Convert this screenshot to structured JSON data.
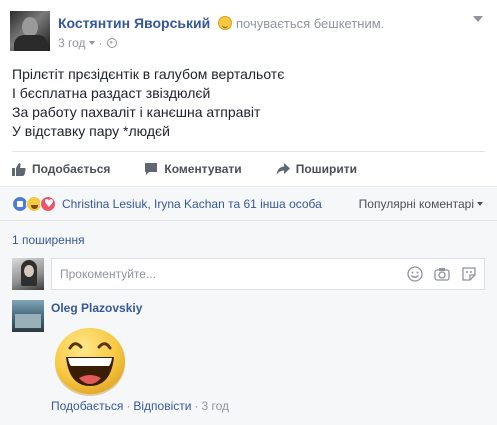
{
  "post": {
    "author": "Костянтин Яворський",
    "activity": "почувається бешкетним.",
    "time": "3 год",
    "lines": [
      "Прілєтіт прєзідєнтік в галубом вертальотє",
      "І бєсплатна раздаст звіздюлєй",
      "За работу пахваліт і канєшна атправіт",
      "У відставку пару *людєй"
    ]
  },
  "actions": {
    "like": "Подобається",
    "comment": "Коментувати",
    "share": "Поширити"
  },
  "reactions": {
    "names": "Christina Lesiuk, Iryna Kachan та 61 інша особа",
    "sort": "Популярні коментарі"
  },
  "shares": "1 поширення",
  "comment_input": {
    "placeholder": "Прокоментуйте..."
  },
  "comment": {
    "author": "Oleg Plazovskiy",
    "like": "Подобається",
    "reply": "Відповісти",
    "time": "3 год"
  },
  "icons": {
    "activity_emoji": "smirk-emoji-icon",
    "privacy": "globe-icon",
    "like": "thumbs-up-icon",
    "comment": "speech-bubble-icon",
    "share": "share-arrow-icon",
    "reactions": [
      "like-reaction-icon",
      "haha-reaction-icon",
      "love-reaction-icon"
    ],
    "input": [
      "emoji-icon",
      "camera-icon",
      "sticker-icon"
    ]
  },
  "colors": {
    "link": "#365899",
    "secondary": "#90949c",
    "background": "#f6f7f9"
  }
}
